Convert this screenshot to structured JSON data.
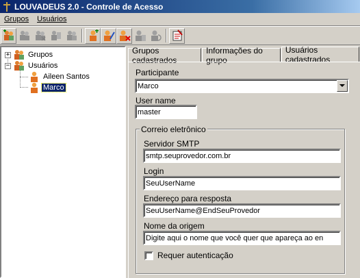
{
  "window": {
    "title": "LOUVADEUS 2.0 - Controle de Acesso"
  },
  "menu": {
    "items": [
      "Grupos",
      "Usuários"
    ]
  },
  "toolbar": {
    "buttons": [
      "add-group-icon",
      "edit-group-icon",
      "delete-group-icon",
      "group-properties-icon",
      "group-users-icon",
      "add-user-icon",
      "edit-user-icon",
      "delete-user-icon",
      "user-properties-icon",
      "user-group-icon",
      "report-icon"
    ]
  },
  "tree": {
    "root_groups": "Grupos",
    "root_users": "Usuários",
    "users": [
      "Aileen Santos",
      "Marco"
    ],
    "selected": "Marco"
  },
  "tabs": [
    "Grupos cadastrados",
    "Informações do grupo",
    "Usuários cadastrados"
  ],
  "form": {
    "participante_label": "Participante",
    "participante_value": "Marco",
    "username_label": "User name",
    "username_value": "master",
    "email_group_title": "Correio eletrônico",
    "smtp_label": "Servidor SMTP",
    "smtp_value": "smtp.seuprovedor.com.br",
    "login_label": "Login",
    "login_value": "SeuUserName",
    "reply_label": "Endereço para resposta",
    "reply_value": "SeuUserName@EndSeuProvedor",
    "origin_label": "Nome da origem",
    "origin_value": "Digite aqui o nome que você quer que apareça ao en",
    "auth_label": "Requer autenticação",
    "auth_checked": false
  },
  "colors": {
    "title_bar": "#0a246a",
    "face": "#d4d0c8",
    "selection": "#0a246a"
  }
}
